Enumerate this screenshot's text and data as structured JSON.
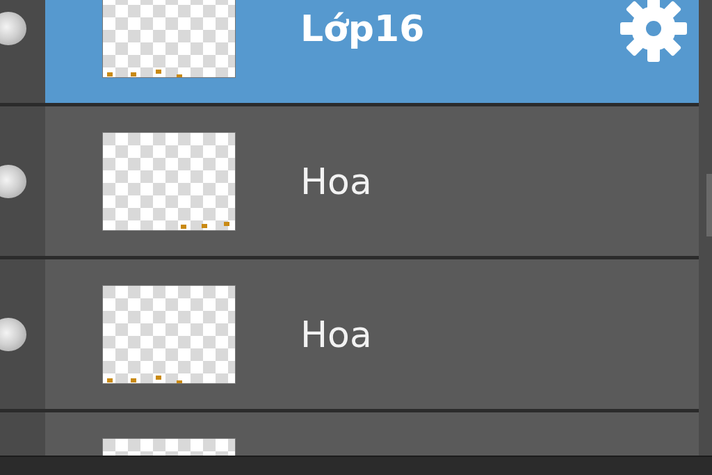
{
  "layers": [
    {
      "name": "Lớp16",
      "selected": true
    },
    {
      "name": "Hoa",
      "selected": false
    },
    {
      "name": "Hoa",
      "selected": false
    },
    {
      "selected": false
    }
  ]
}
